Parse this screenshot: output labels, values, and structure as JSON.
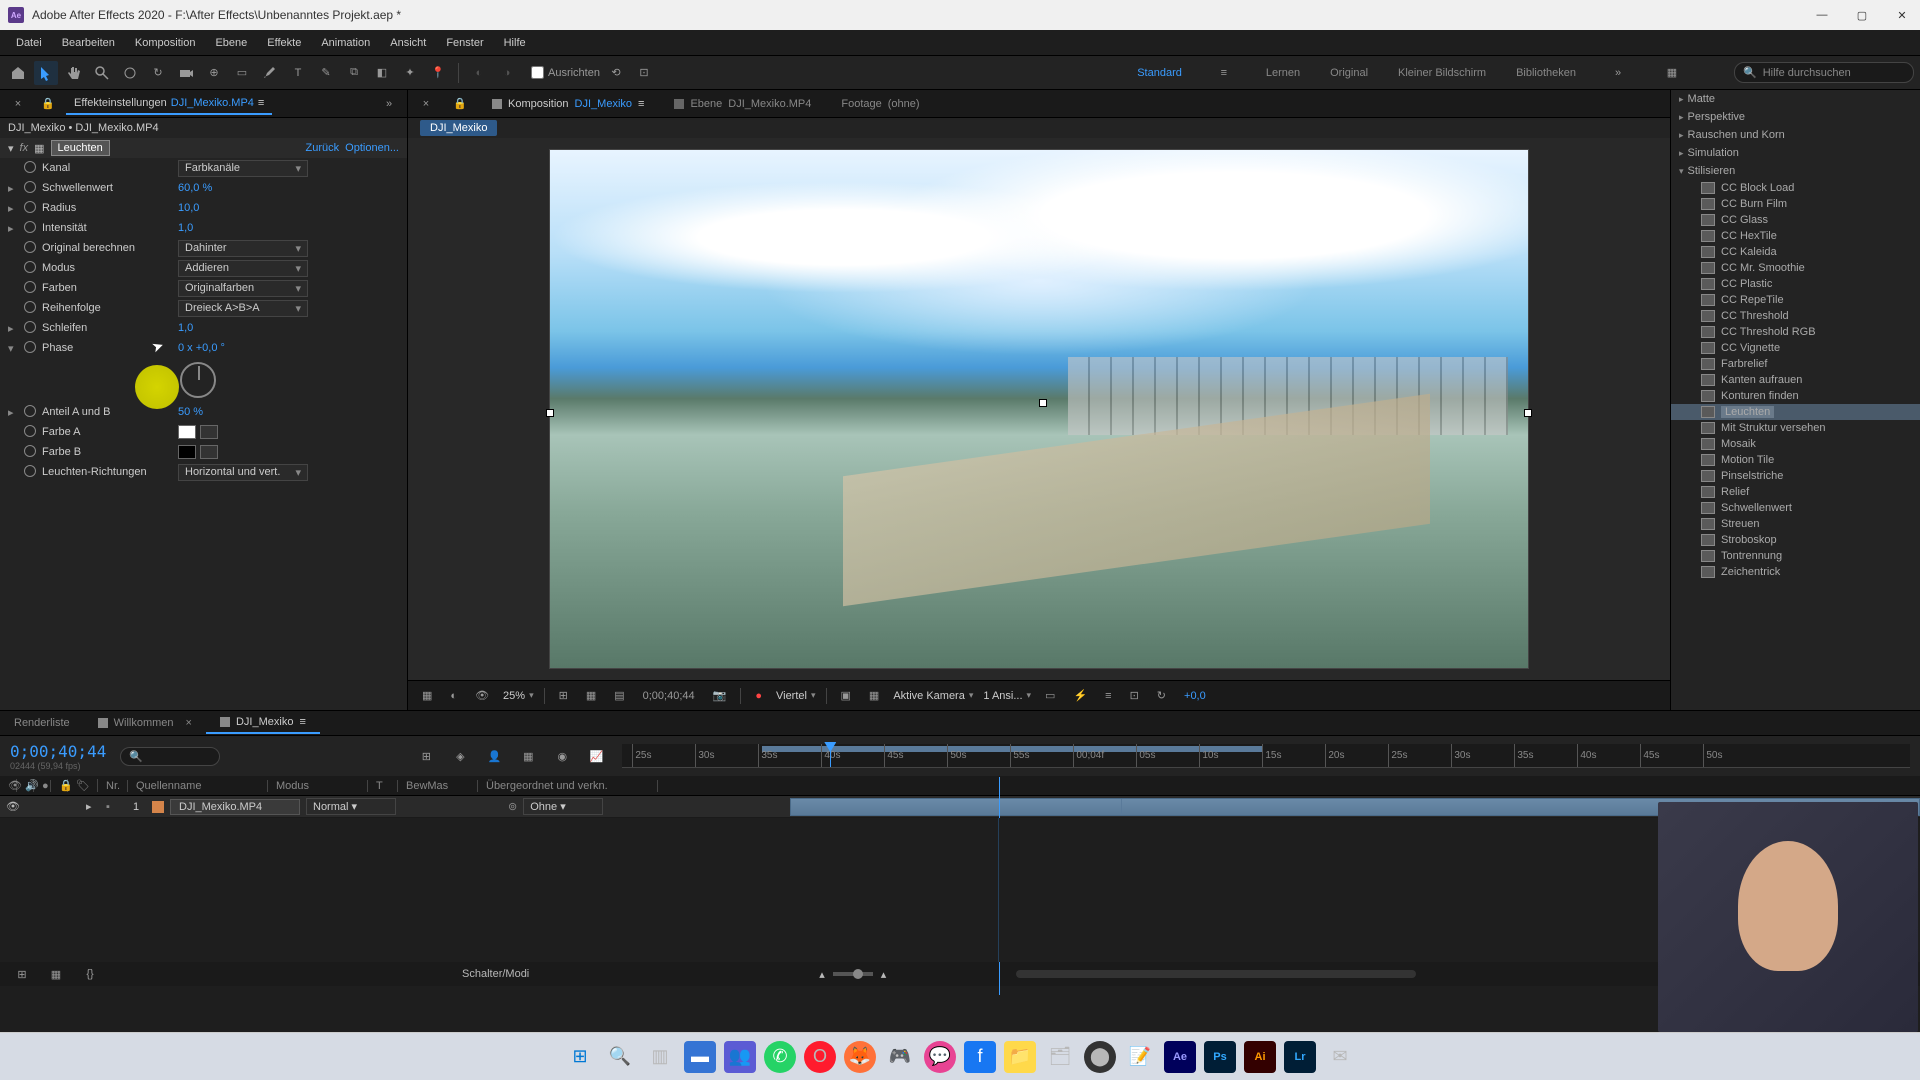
{
  "titlebar": {
    "app_icon": "Ae",
    "title": "Adobe After Effects 2020 - F:\\After Effects\\Unbenanntes Projekt.aep *"
  },
  "menubar": [
    "Datei",
    "Bearbeiten",
    "Komposition",
    "Ebene",
    "Effekte",
    "Animation",
    "Ansicht",
    "Fenster",
    "Hilfe"
  ],
  "toolbar": {
    "ausrichten": "Ausrichten",
    "workspaces": [
      "Standard",
      "Lernen",
      "Original",
      "Kleiner Bildschirm",
      "Bibliotheken"
    ],
    "active_workspace": "Standard",
    "search_placeholder": "Hilfe durchsuchen"
  },
  "left_panel": {
    "tab_label": "Effekteinstellungen",
    "tab_file": "DJI_Mexiko.MP4",
    "breadcrumb": "DJI_Mexiko • DJI_Mexiko.MP4",
    "effect": {
      "name": "Leuchten",
      "reset": "Zurück",
      "options": "Optionen...",
      "params": {
        "kanal": {
          "label": "Kanal",
          "value": "Farbkanäle"
        },
        "schwellenwert": {
          "label": "Schwellenwert",
          "value": "60,0 %"
        },
        "radius": {
          "label": "Radius",
          "value": "10,0"
        },
        "intensitaet": {
          "label": "Intensität",
          "value": "1,0"
        },
        "original": {
          "label": "Original berechnen",
          "value": "Dahinter"
        },
        "modus": {
          "label": "Modus",
          "value": "Addieren"
        },
        "farben": {
          "label": "Farben",
          "value": "Originalfarben"
        },
        "reihenfolge": {
          "label": "Reihenfolge",
          "value": "Dreieck A>B>A"
        },
        "schleifen": {
          "label": "Schleifen",
          "value": "1,0"
        },
        "phase": {
          "label": "Phase",
          "value": "0 x +0,0 °"
        },
        "anteil": {
          "label": "Anteil A und B",
          "value": "50 %"
        },
        "farbeA": {
          "label": "Farbe A"
        },
        "farbeB": {
          "label": "Farbe B"
        },
        "richtungen": {
          "label": "Leuchten-Richtungen",
          "value": "Horizontal und vert."
        }
      }
    }
  },
  "center_panel": {
    "tabs": [
      {
        "label": "Komposition",
        "file": "DJI_Mexiko",
        "active": true
      },
      {
        "label": "Ebene",
        "file": "DJI_Mexiko.MP4"
      },
      {
        "label": "Footage",
        "file": "(ohne)"
      }
    ],
    "breadcrumb": "DJI_Mexiko",
    "viewer_toolbar": {
      "zoom": "25%",
      "timecode": "0;00;40;44",
      "quality": "Viertel",
      "camera": "Aktive Kamera",
      "views": "1 Ansi...",
      "exposure": "+0,0"
    }
  },
  "right_panel": {
    "categories": [
      "Matte",
      "Perspektive",
      "Rauschen und Korn",
      "Simulation"
    ],
    "expanded_category": "Stilisieren",
    "effects": [
      "CC Block Load",
      "CC Burn Film",
      "CC Glass",
      "CC HexTile",
      "CC Kaleida",
      "CC Mr. Smoothie",
      "CC Plastic",
      "CC RepeTile",
      "CC Threshold",
      "CC Threshold RGB",
      "CC Vignette",
      "Farbrelief",
      "Kanten aufrauen",
      "Konturen finden",
      "Leuchten",
      "Mit Struktur versehen",
      "Mosaik",
      "Motion Tile",
      "Pinselstriche",
      "Relief",
      "Schwellenwert",
      "Streuen",
      "Stroboskop",
      "Tontrennung",
      "Zeichentrick"
    ],
    "selected_effect": "Leuchten"
  },
  "bottom_tabs": [
    {
      "label": "Renderliste"
    },
    {
      "label": "Willkommen",
      "closable": true
    },
    {
      "label": "DJI_Mexiko",
      "closable": true,
      "active": true
    }
  ],
  "timeline": {
    "timecode": "0;00;40;44",
    "subtime": "02444 (59,94 fps)",
    "columns": {
      "nr": "Nr.",
      "quelle": "Quellenname",
      "modus": "Modus",
      "t": "T",
      "bewmas": "BewMas",
      "ueber": "Übergeordnet und verkn."
    },
    "ticks": [
      "25s",
      "30s",
      "35s",
      "40s",
      "45s",
      "50s",
      "55s",
      "00;04f",
      "05s",
      "10s",
      "15s",
      "20s",
      "25s",
      "30s",
      "35s",
      "40s",
      "45s",
      "50s"
    ],
    "layer": {
      "num": "1",
      "name": "DJI_Mexiko.MP4",
      "mode": "Normal",
      "parent": "Ohne"
    },
    "footer": "Schalter/Modi"
  },
  "taskbar_icons": [
    "windows",
    "search",
    "taskview",
    "explorer",
    "teams",
    "whatsapp",
    "opera",
    "firefox",
    "app1",
    "messenger",
    "facebook",
    "folder",
    "app2",
    "obs",
    "notepad",
    "aftereffects",
    "photoshop",
    "illustrator",
    "lightroom",
    "app3"
  ]
}
